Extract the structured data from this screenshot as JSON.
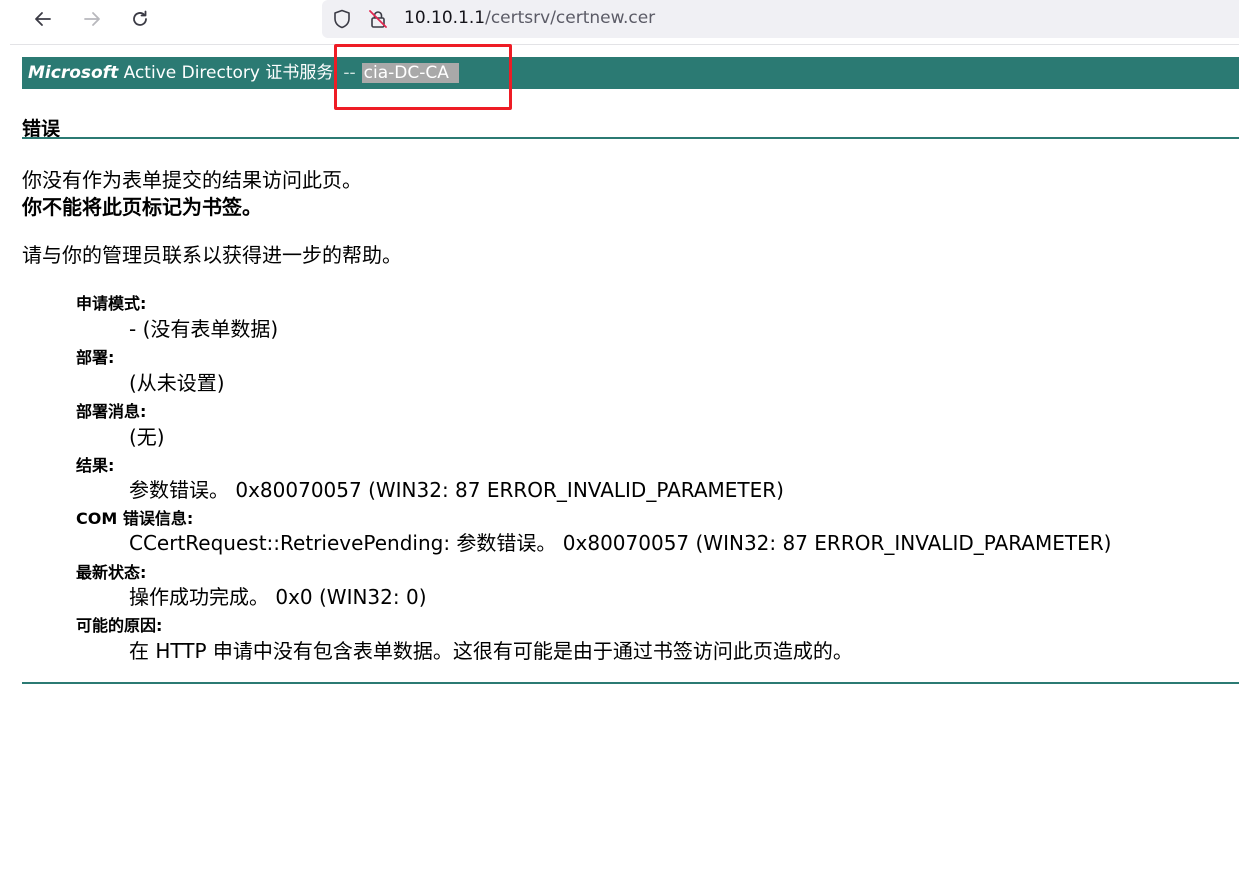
{
  "browser": {
    "url_host": "10.10.1.1",
    "url_path": "/certsrv/certnew.cer"
  },
  "banner": {
    "microsoft": "Microsoft",
    "product": " Active Directory 证书服务",
    "separator": "--",
    "ca_name": "cia-DC-CA"
  },
  "page": {
    "heading": "错误",
    "message_line1": "你没有作为表单提交的结果访问此页。",
    "message_line2": "你不能将此页标记为书签。",
    "contact": "请与你的管理员联系以获得进一步的帮助。"
  },
  "details": [
    {
      "label": "申请模式:",
      "value": "- (没有表单数据)"
    },
    {
      "label": "部署:",
      "value": "(从未设置)"
    },
    {
      "label": "部署消息:",
      "value": "(无)"
    },
    {
      "label": "结果:",
      "value": "参数错误。 0x80070057 (WIN32: 87 ERROR_INVALID_PARAMETER)"
    },
    {
      "label": "COM 错误信息:",
      "value": "CCertRequest::RetrievePending: 参数错误。 0x80070057 (WIN32: 87 ERROR_INVALID_PARAMETER)"
    },
    {
      "label": "最新状态:",
      "value": "操作成功完成。 0x0 (WIN32: 0)"
    },
    {
      "label": "可能的原因:",
      "value": "在 HTTP 申请中没有包含表单数据。这很有可能是由于通过书签访问此页造成的。"
    }
  ],
  "annotation": {
    "color": "#ee1c25"
  },
  "colors": {
    "banner": "#2b7a73",
    "ca_highlight": "#a9a9a9"
  }
}
